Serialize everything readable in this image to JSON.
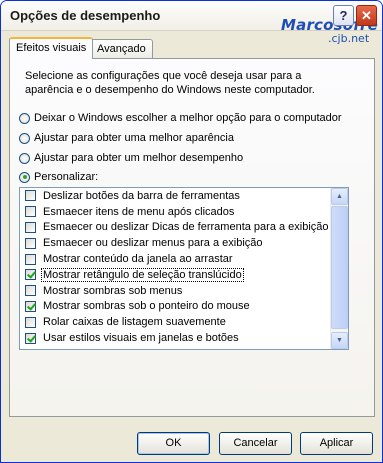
{
  "window": {
    "title": "Opções de desempenho",
    "help_label": "?",
    "close_label": "✕",
    "watermark": {
      "brand": "Marcosofre",
      "site": ".cjb.net"
    }
  },
  "tabs": [
    {
      "label": "Efeitos visuais",
      "active": true
    },
    {
      "label": "Avançado",
      "active": false
    }
  ],
  "description": "Selecione as configurações que você deseja usar para a aparência e o desempenho do Windows neste computador.",
  "radios": [
    {
      "label": "Deixar o Windows escolher a melhor opção para o computador",
      "checked": false
    },
    {
      "label": "Ajustar para obter uma melhor aparência",
      "checked": false
    },
    {
      "label": "Ajustar para obter um melhor desempenho",
      "checked": false
    },
    {
      "label": "Personalizar:",
      "checked": true
    }
  ],
  "effects": [
    {
      "label": "Deslizar botões da barra de ferramentas",
      "checked": false
    },
    {
      "label": "Esmaecer itens de menu após clicados",
      "checked": false
    },
    {
      "label": "Esmaecer ou deslizar Dicas de ferramenta para a exibição",
      "checked": false
    },
    {
      "label": "Esmaecer ou deslizar menus para a exibição",
      "checked": false
    },
    {
      "label": "Mostrar conteúdo da janela ao arrastar",
      "checked": false
    },
    {
      "label": "Mostrar retângulo de seleção translúcido",
      "checked": true,
      "selected": true
    },
    {
      "label": "Mostrar sombras sob menus",
      "checked": false
    },
    {
      "label": "Mostrar sombras sob o ponteiro do mouse",
      "checked": true
    },
    {
      "label": "Rolar caixas de listagem suavemente",
      "checked": false
    },
    {
      "label": "Usar estilos visuais em janelas e botões",
      "checked": true
    }
  ],
  "buttons": {
    "ok": "OK",
    "cancel": "Cancelar",
    "apply": "Aplicar"
  },
  "colors": {
    "accent_tab": "#f5b43d",
    "check_green": "#21a121",
    "border_blue": "#7f9db9"
  }
}
